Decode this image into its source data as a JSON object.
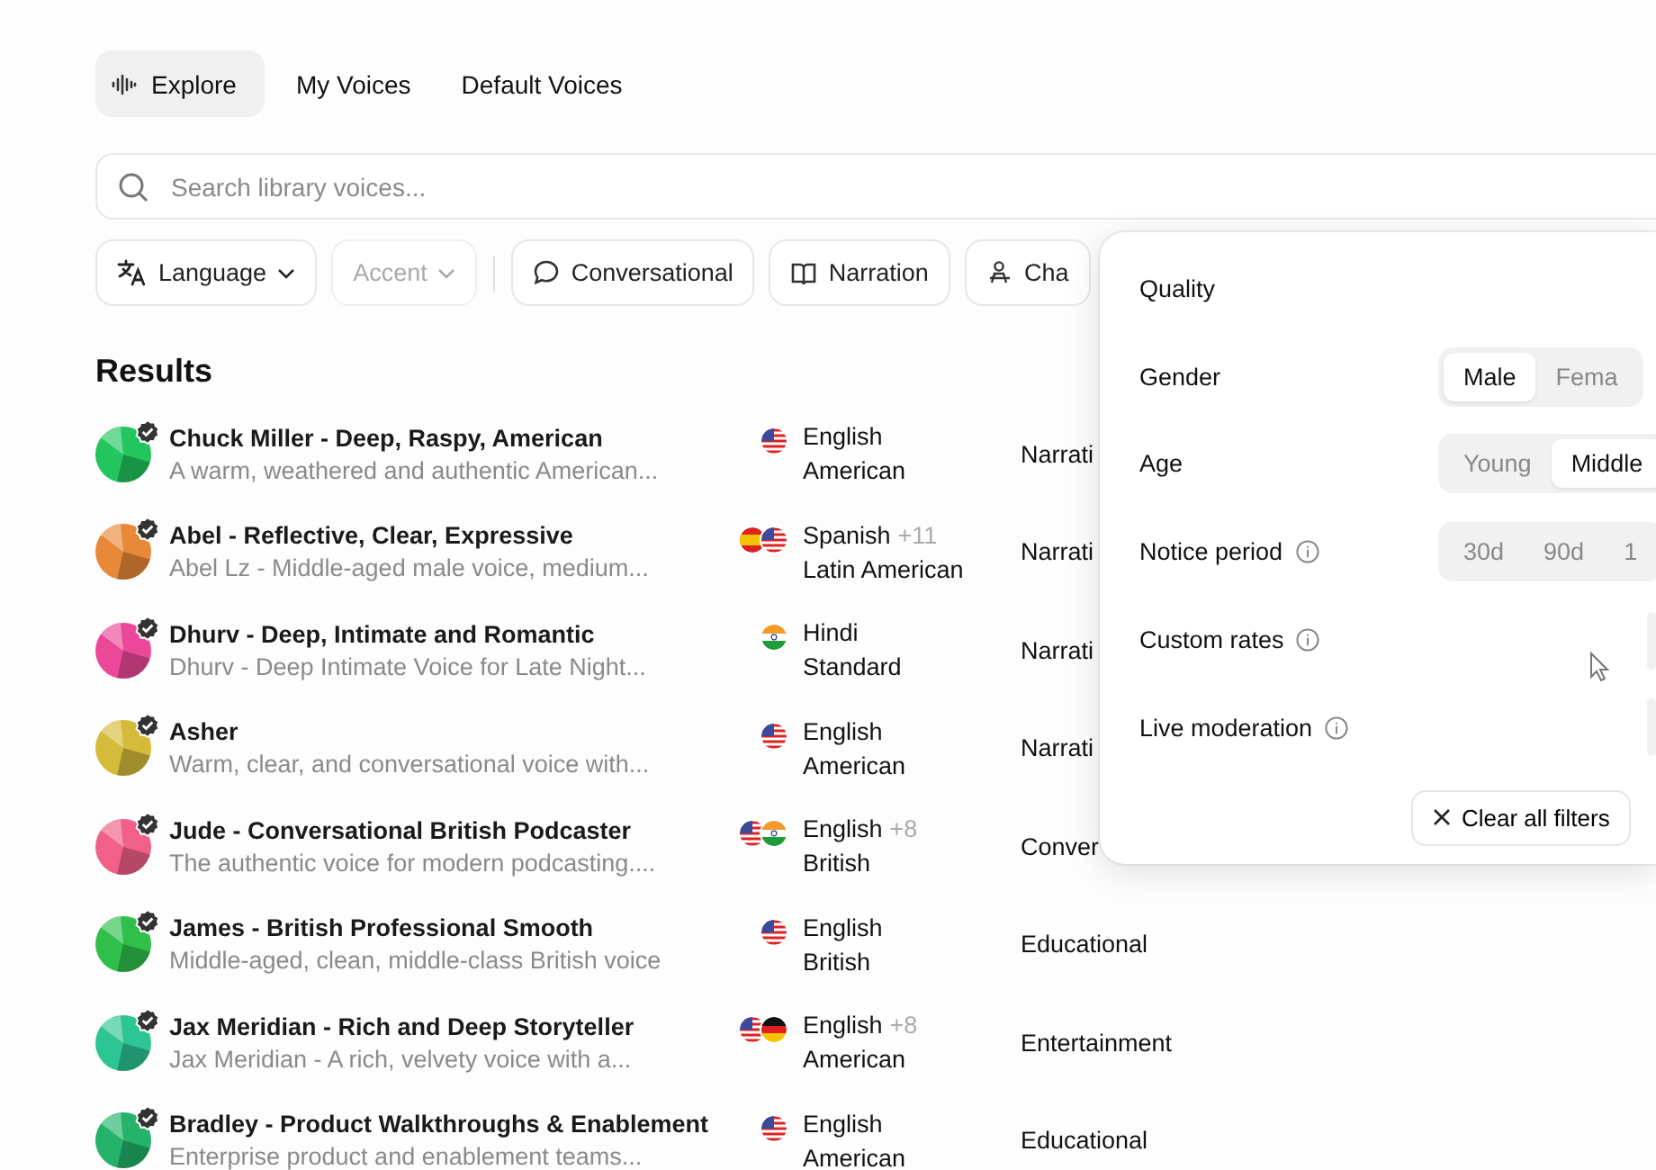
{
  "tabs": [
    {
      "label": "Explore",
      "selected": true,
      "kind": "wave"
    },
    {
      "label": "My Voices",
      "selected": false,
      "kind": "none"
    },
    {
      "label": "Default Voices",
      "selected": false,
      "kind": "none"
    }
  ],
  "search": {
    "placeholder": "Search library voices..."
  },
  "filters": [
    {
      "label": "Language",
      "kind": "translate",
      "dropdown": true,
      "disabled": false
    },
    {
      "label": "Accent",
      "kind": "none",
      "dropdown": true,
      "disabled": true
    },
    {
      "label": "Conversational",
      "kind": "chat",
      "dropdown": false,
      "disabled": false
    },
    {
      "label": "Narration",
      "kind": "book",
      "dropdown": false,
      "disabled": false
    },
    {
      "label": "Cha",
      "kind": "person",
      "dropdown": false,
      "disabled": false
    }
  ],
  "results_title": "Results",
  "voices": [
    {
      "name": "Chuck Miller - Deep, Raspy, American",
      "description": "A warm, weathered and authentic American...",
      "color": "#22c55e",
      "flags": [
        {
          "kind": "us"
        }
      ],
      "language": "English",
      "accent": "American",
      "category": "Narrati"
    },
    {
      "name": "Abel - Reflective, Clear, Expressive",
      "description": "Abel Lz - Middle-aged male voice, medium...",
      "color": "#e8893a",
      "flags": [
        {
          "kind": "es"
        },
        {
          "kind": "us"
        }
      ],
      "language": "Spanish",
      "extra": "+11",
      "accent": "Latin American",
      "category": "Narrati"
    },
    {
      "name": "Dhurv - Deep, Intimate and Romantic",
      "description": "Dhurv - Deep Intimate Voice for Late Night...",
      "color": "#ec4899",
      "flags": [
        {
          "kind": "in"
        }
      ],
      "language": "Hindi",
      "accent": "Standard",
      "category": "Narrati"
    },
    {
      "name": "Asher",
      "description": "Warm, clear, and conversational voice with...",
      "color": "#d4bb3a",
      "flags": [
        {
          "kind": "us"
        }
      ],
      "language": "English",
      "accent": "American",
      "category": "Narrati"
    },
    {
      "name": "Jude - Conversational British Podcaster",
      "description": "The authentic voice for modern podcasting....",
      "color": "#f06088",
      "flags": [
        {
          "kind": "us"
        },
        {
          "kind": "in"
        }
      ],
      "language": "English",
      "extra": "+8",
      "accent": "British",
      "category": "Conver"
    },
    {
      "name": "James - British Professional Smooth",
      "description": "Middle-aged, clean, middle-class British voice",
      "color": "#2fbf4a",
      "flags": [
        {
          "kind": "us"
        }
      ],
      "language": "English",
      "accent": "British",
      "category": "Educational"
    },
    {
      "name": "Jax Meridian - Rich and Deep Storyteller",
      "description": "Jax Meridian - A rich, velvety voice with a...",
      "color": "#2ec594",
      "flags": [
        {
          "kind": "us"
        },
        {
          "kind": "de"
        }
      ],
      "language": "English",
      "extra": "+8",
      "accent": "American",
      "category": "Entertainment"
    },
    {
      "name": "Bradley - Product Walkthroughs & Enablement",
      "description": "Enterprise product and enablement teams...",
      "color": "#25b26a",
      "flags": [
        {
          "kind": "us"
        }
      ],
      "language": "English",
      "accent": "American",
      "category": "Educational"
    }
  ],
  "popup": {
    "rows": [
      {
        "label": "Quality",
        "info": false,
        "kind": "none"
      },
      {
        "label": "Gender",
        "info": false,
        "kind": "segmented",
        "options": [
          {
            "label": "Male",
            "selected": true
          },
          {
            "label": "Fema",
            "selected": false
          }
        ]
      },
      {
        "label": "Age",
        "info": false,
        "kind": "segmented",
        "options": [
          {
            "label": "Young",
            "selected": false
          },
          {
            "label": "Middle",
            "selected": true
          }
        ]
      },
      {
        "label": "Notice period",
        "info": true,
        "kind": "segmented",
        "options": [
          {
            "label": "30d",
            "selected": false
          },
          {
            "label": "90d",
            "selected": false
          },
          {
            "label": "1",
            "selected": false
          }
        ]
      },
      {
        "label": "Custom rates",
        "info": true,
        "kind": "stub"
      },
      {
        "label": "Live moderation",
        "info": true,
        "kind": "stub"
      }
    ],
    "clear_button": "Clear all filters"
  }
}
